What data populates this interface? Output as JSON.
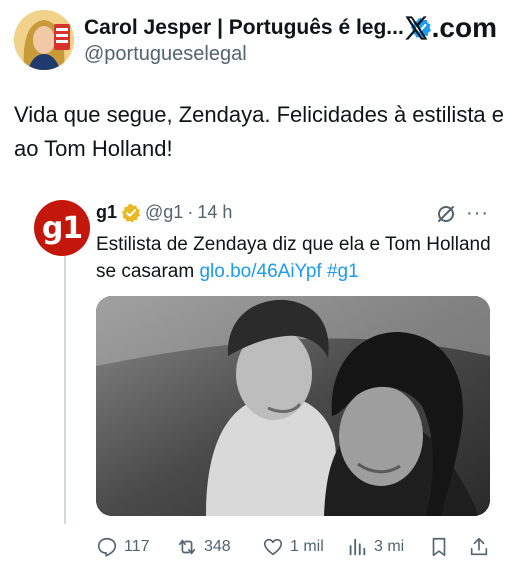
{
  "author": {
    "name": "Carol Jesper | Português é leg...",
    "handle": "@portugueselegal"
  },
  "brand": {
    "label": ".com"
  },
  "tweet": {
    "text": "Vida que segue, Zendaya. Felicidades à estilista e ao Tom Holland!"
  },
  "quote": {
    "avatar_text": "g1",
    "name": "g1",
    "handle": "@g1",
    "separator": "·",
    "time": "14 h",
    "text": "Estilista de Zendaya diz que ela e Tom Holland se casaram ",
    "link": "glo.bo/46AiYpf",
    "hashtag": "#g1",
    "more": "···"
  },
  "actions": {
    "replies": "117",
    "reposts": "348",
    "likes": "1 mil",
    "views": "3 mi"
  },
  "colors": {
    "accent": "#1d9bf0",
    "g1_red": "#c4170c",
    "gold": "#e8b923"
  }
}
